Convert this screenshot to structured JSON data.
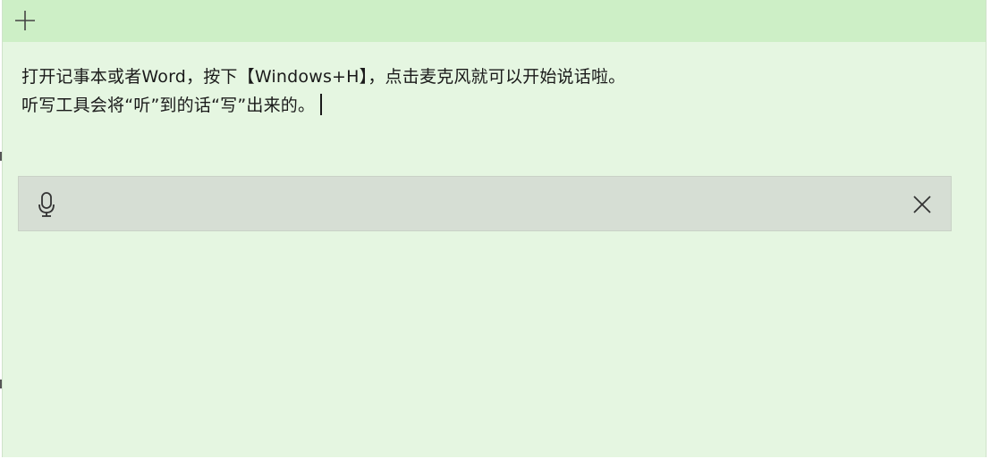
{
  "toolbar": {
    "add_icon": "plus-icon"
  },
  "note": {
    "lines": [
      "打开记事本或者Word，按下【Windows+H】，点击麦克风就可以开始说话啦。",
      "听写工具会将“听”到的话“写”出来的。"
    ]
  },
  "dictation": {
    "mic_icon": "microphone-icon",
    "close_icon": "close-icon"
  },
  "colors": {
    "titlebar": "#cdefc6",
    "background": "#e5f6e1",
    "dictation_bar": "#d6ded4",
    "text": "#1a1a1a"
  }
}
